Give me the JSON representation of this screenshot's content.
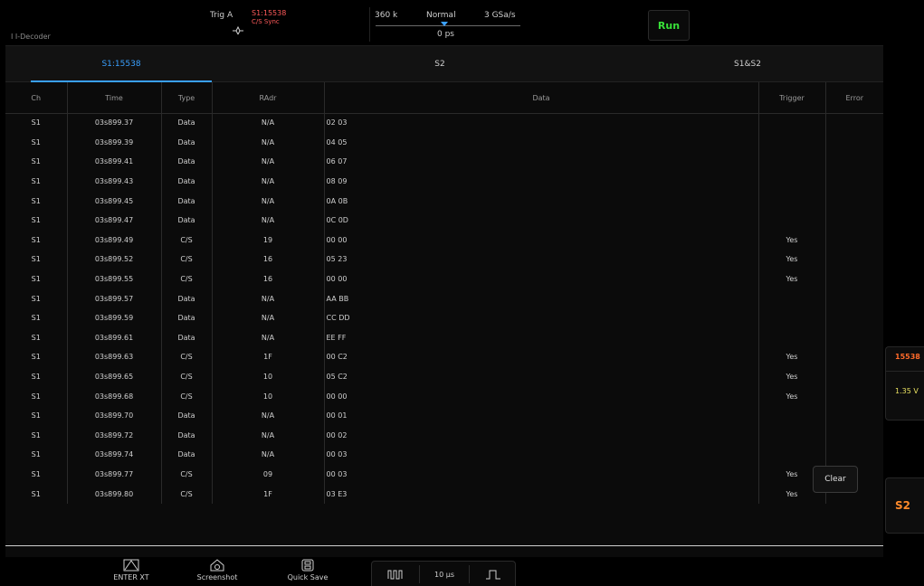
{
  "header": {
    "mode_label": "I I-Decoder",
    "trigger": {
      "label": "Trig A",
      "source": "S1:15538",
      "mode": "C/S Sync"
    },
    "acquisition": {
      "depth": "360 k",
      "mode": "Normal",
      "rate": "3 GSa/s",
      "position": "0 ps"
    },
    "run_label": "Run"
  },
  "tabs": [
    {
      "label": "S1:15538",
      "active": true
    },
    {
      "label": "S2",
      "active": false
    },
    {
      "label": "S1&S2",
      "active": false
    }
  ],
  "table": {
    "columns": [
      "Ch",
      "Time",
      "Type",
      "RAdr",
      "Data",
      "Trigger",
      "Error"
    ],
    "rows": [
      [
        "S1",
        "03s899.37",
        "Data",
        "N/A",
        "02 03",
        "",
        ""
      ],
      [
        "S1",
        "03s899.39",
        "Data",
        "N/A",
        "04 05",
        "",
        ""
      ],
      [
        "S1",
        "03s899.41",
        "Data",
        "N/A",
        "06 07",
        "",
        ""
      ],
      [
        "S1",
        "03s899.43",
        "Data",
        "N/A",
        "08 09",
        "",
        ""
      ],
      [
        "S1",
        "03s899.45",
        "Data",
        "N/A",
        "0A 0B",
        "",
        ""
      ],
      [
        "S1",
        "03s899.47",
        "Data",
        "N/A",
        "0C 0D",
        "",
        ""
      ],
      [
        "S1",
        "03s899.49",
        "C/S",
        "19",
        "00 00",
        "Yes",
        ""
      ],
      [
        "S1",
        "03s899.52",
        "C/S",
        "16",
        "05 23",
        "Yes",
        ""
      ],
      [
        "S1",
        "03s899.55",
        "C/S",
        "16",
        "00 00",
        "Yes",
        ""
      ],
      [
        "S1",
        "03s899.57",
        "Data",
        "N/A",
        "AA BB",
        "",
        ""
      ],
      [
        "S1",
        "03s899.59",
        "Data",
        "N/A",
        "CC DD",
        "",
        ""
      ],
      [
        "S1",
        "03s899.61",
        "Data",
        "N/A",
        "EE FF",
        "",
        ""
      ],
      [
        "S1",
        "03s899.63",
        "C/S",
        "1F",
        "00 C2",
        "Yes",
        ""
      ],
      [
        "S1",
        "03s899.65",
        "C/S",
        "10",
        "05 C2",
        "Yes",
        ""
      ],
      [
        "S1",
        "03s899.68",
        "C/S",
        "10",
        "00 00",
        "Yes",
        ""
      ],
      [
        "S1",
        "03s899.70",
        "Data",
        "N/A",
        "00 01",
        "",
        ""
      ],
      [
        "S1",
        "03s899.72",
        "Data",
        "N/A",
        "00 02",
        "",
        ""
      ],
      [
        "S1",
        "03s899.74",
        "Data",
        "N/A",
        "00 03",
        "",
        ""
      ],
      [
        "S1",
        "03s899.77",
        "C/S",
        "09",
        "00 03",
        "Yes",
        ""
      ],
      [
        "S1",
        "03s899.80",
        "C/S",
        "1F",
        "03 E3",
        "Yes",
        ""
      ]
    ]
  },
  "clear_label": "Clear",
  "side": {
    "count": "15538",
    "volt": "1.35 V",
    "s2_label": "S2"
  },
  "toolbar": {
    "enter_label": "ENTER XT",
    "screenshot_label": "Screenshot",
    "quicksave_label": "Quick Save",
    "timebase": "10 µs"
  },
  "colors": {
    "accent": "#3aa0ff",
    "run": "#38e038",
    "trigger": "#ff5a5a",
    "s2": "#ff8a2a",
    "volt": "#e8e060"
  }
}
